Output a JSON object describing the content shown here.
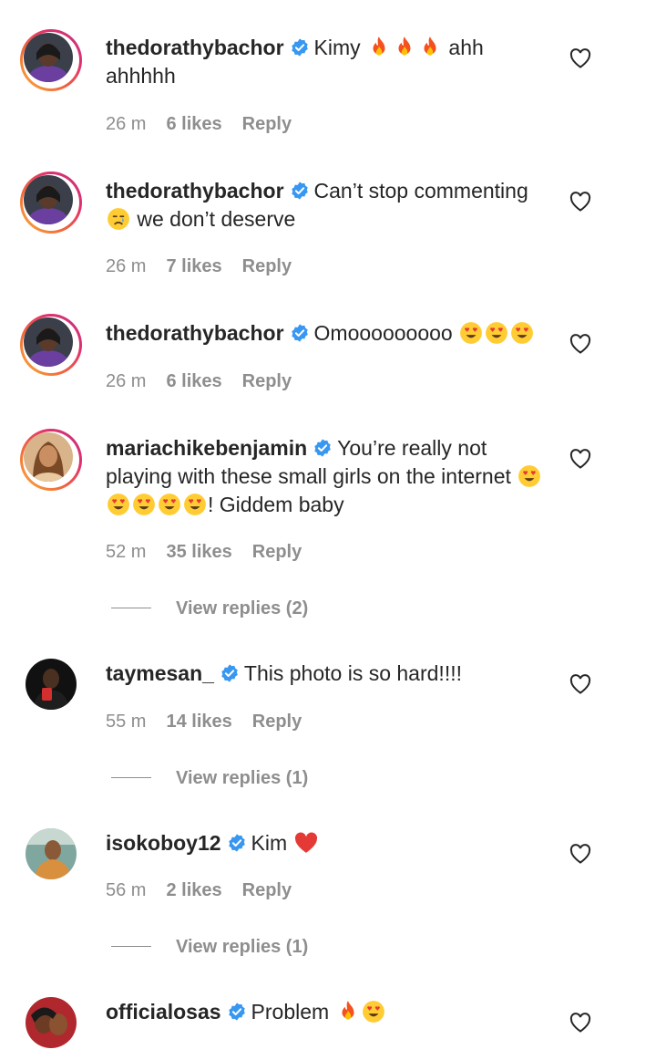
{
  "comments": [
    {
      "username": "thedorathybachor",
      "text_before": "Kimy ",
      "emojis": [
        "fire",
        "fire",
        "fire"
      ],
      "text_after": " ahh ahhhhh",
      "time": "26 m",
      "likes": "6 likes",
      "reply": "Reply"
    },
    {
      "username": "thedorathybachor",
      "text_before": "Can’t stop commenting ",
      "emojis": [
        "crying-face"
      ],
      "text_after": " we don’t deserve",
      "time": "26 m",
      "likes": "7 likes",
      "reply": "Reply"
    },
    {
      "username": "thedorathybachor",
      "text_before": "Omooooooooo ",
      "emojis": [
        "heart-eyes",
        "heart-eyes",
        "heart-eyes"
      ],
      "text_after": "",
      "time": "26 m",
      "likes": "6 likes",
      "reply": "Reply"
    },
    {
      "username": "mariachikebenjamin",
      "text_before": "You’re really not playing with these small girls on the internet ",
      "emojis": [
        "heart-eyes",
        "heart-eyes",
        "heart-eyes",
        "heart-eyes",
        "heart-eyes"
      ],
      "text_after": "! Giddem baby",
      "time": "52 m",
      "likes": "35 likes",
      "reply": "Reply",
      "view_replies": "View replies (2)"
    },
    {
      "username": "taymesan_",
      "text_before": "This photo is so hard!!!!",
      "emojis": [],
      "text_after": "",
      "time": "55 m",
      "likes": "14 likes",
      "reply": "Reply",
      "view_replies": "View replies (1)"
    },
    {
      "username": "isokoboy12",
      "text_before": "Kim ",
      "emojis": [
        "red-heart"
      ],
      "text_after": "",
      "time": "56 m",
      "likes": "2 likes",
      "reply": "Reply",
      "view_replies": "View replies (1)"
    },
    {
      "username": "officialosas",
      "text_before": "Problem ",
      "emojis": [
        "fire",
        "heart-eyes"
      ],
      "text_after": "",
      "time": "",
      "likes": "",
      "reply": ""
    }
  ],
  "colors": {
    "text": "#262626",
    "muted": "#8e8e8e",
    "verified": "#3897f0",
    "story_ring_start": "#f9b23a",
    "story_ring_end": "#c13584"
  },
  "icons": {
    "verified": "verified-badge-icon",
    "like": "heart-outline-icon"
  }
}
